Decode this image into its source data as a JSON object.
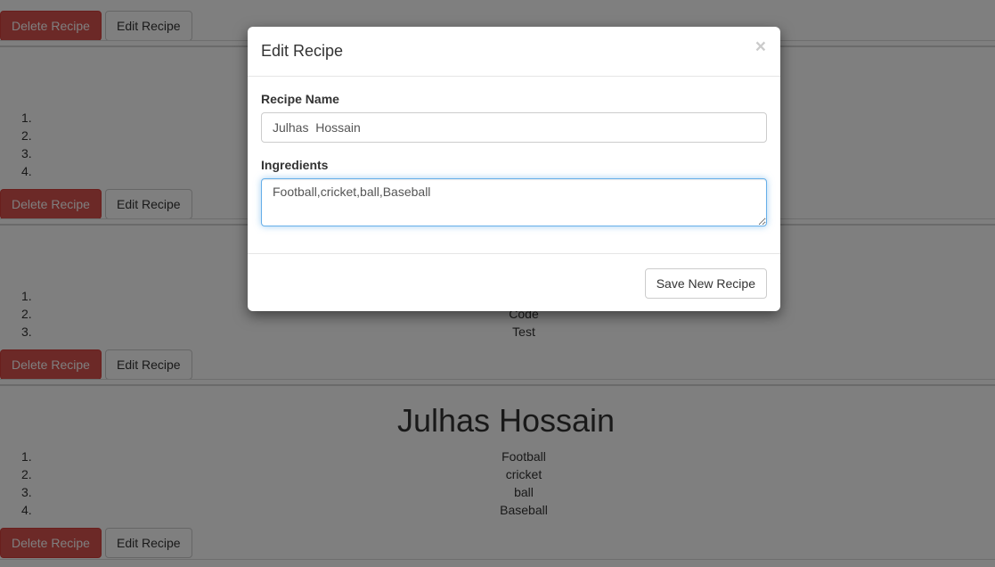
{
  "page": {
    "delete_label": "Delete Recipe",
    "edit_label": "Edit Recipe",
    "recipes": [
      {
        "title": "",
        "ingredients": [
          "",
          "",
          "",
          ""
        ]
      },
      {
        "title": "",
        "ingredients": [
          "",
          "Code",
          "Test"
        ]
      },
      {
        "title": "Julhas Hossain",
        "ingredients": [
          "Football",
          "cricket",
          "ball",
          "Baseball"
        ]
      }
    ]
  },
  "modal": {
    "title": "Edit Recipe",
    "close_glyph": "×",
    "name_label": "Recipe Name",
    "name_value": "Julhas  Hossain",
    "ingredients_label": "Ingredients",
    "ingredients_value": "Football,cricket,ball,Baseball",
    "save_label": "Save New Recipe"
  },
  "colors": {
    "danger": "#d9534f",
    "focus_border": "#66afe9",
    "backdrop": "rgba(0,0,0,0.5)"
  }
}
